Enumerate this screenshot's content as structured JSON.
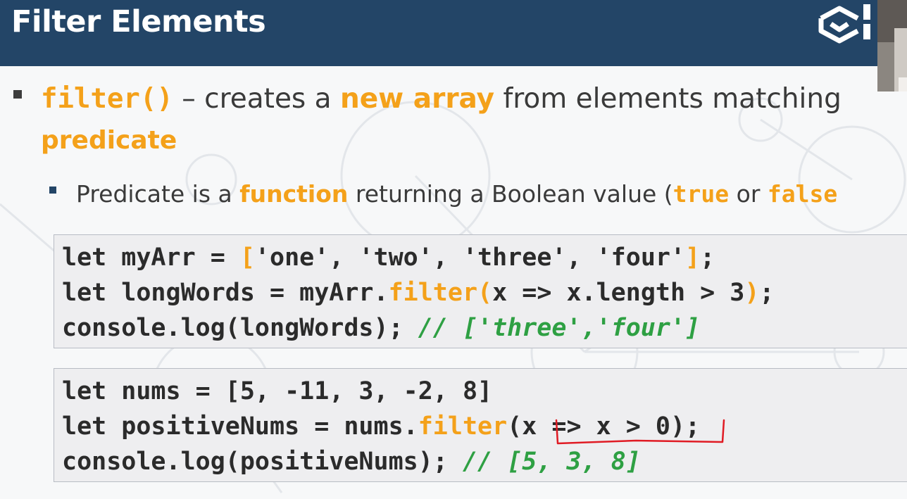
{
  "slide": {
    "title": "Filter Elements"
  },
  "bullet1": {
    "method": "filter()",
    "text_a": " – creates a ",
    "highlight1": "new array",
    "text_b": " from elements matching",
    "highlight2": "predicate"
  },
  "bullet2": {
    "text_a": "Predicate is a ",
    "highlight1": "function",
    "text_b": " returning a Boolean value (",
    "kw_true": "true",
    "text_c": " or ",
    "kw_false": "false"
  },
  "code1": {
    "l1_a": "let myArr = ",
    "l1_b": "[",
    "l1_c": "'one', 'two', 'three', 'four'",
    "l1_d": "]",
    "l1_e": ";",
    "l2_a": "let longWords = myArr.",
    "l2_b": "filter(",
    "l2_c": "x => x.length > 3",
    "l2_d": ")",
    "l2_e": ";",
    "l3_a": "console.log(longWords); ",
    "l3_b": "// ['three','four']"
  },
  "code2": {
    "l1": "let nums = [5, -11, 3, -2, 8]",
    "l2_a": "let positiveNums = nums.",
    "l2_b": "filter",
    "l2_c": "(x => x > 0);",
    "l3_a": "console.log(positiveNums); ",
    "l3_b": "// [5, 3, 8]"
  },
  "colors": {
    "header": "#234567",
    "accent": "#f4a11a",
    "comment": "#2ea043",
    "annotation": "#e01b24"
  },
  "icons": {
    "logo": "cube-logo-icon"
  }
}
